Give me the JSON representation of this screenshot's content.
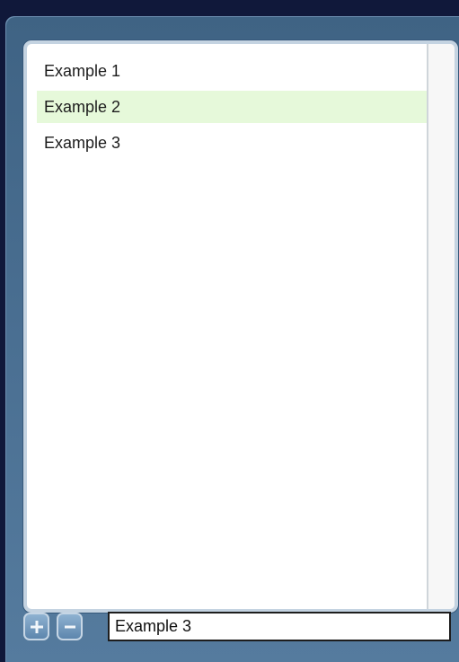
{
  "list": {
    "items": [
      {
        "label": "Example 1",
        "selected": false
      },
      {
        "label": "Example 2",
        "selected": true
      },
      {
        "label": "Example 3",
        "selected": false
      }
    ]
  },
  "controls": {
    "add_icon": "plus-icon",
    "remove_icon": "minus-icon",
    "input_value": "Example 3"
  },
  "colors": {
    "selection_highlight": "#e6f9da",
    "panel_background": "#4a6f92",
    "frame_border": "#c4d3e1"
  }
}
